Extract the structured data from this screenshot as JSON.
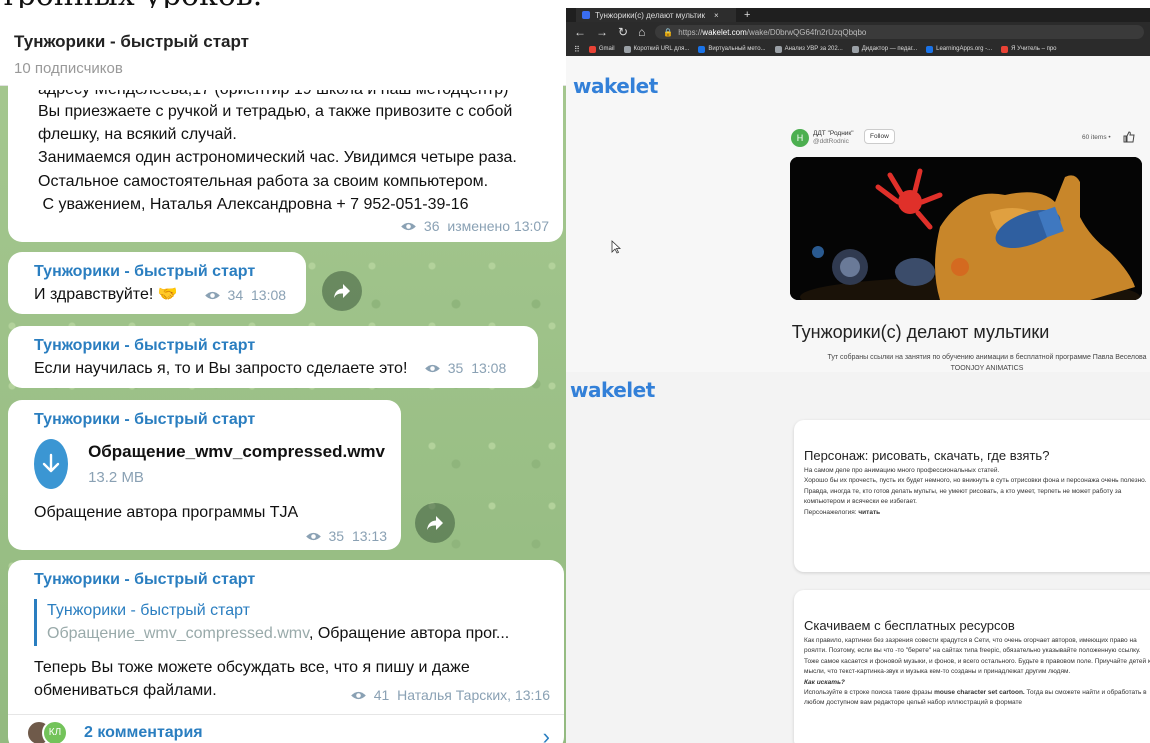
{
  "doc_fragment": "тронных уроков.",
  "telegram": {
    "channel_title": "Тунжорики - быстрый старт",
    "subscribers": "10 подписчиков",
    "messages": [
      {
        "cut_line": "адресу Менделеева,17 (ориентир 19 школа и наш методцентр)",
        "lines": [
          "Вы приезжаете с ручкой и тетрадью, а также привозите с собой",
          "флешку, на всякий случай.",
          "Занимаемся один астрономический час. Увидимся четыре раза.",
          "Остальное самостоятельная работа за своим компьютером.",
          " С уважением, Наталья Александровна + 7 952-051-39-16"
        ],
        "views": "36",
        "time": "изменено 13:07"
      },
      {
        "sender": "Тунжорики - быстрый старт",
        "text": "И здравствуйте! 🤝",
        "views": "34",
        "time": "13:08"
      },
      {
        "sender": "Тунжорики - быстрый старт",
        "text": "Если научилась я, то и Вы запросто сделаете это!",
        "views": "35",
        "time": "13:08"
      },
      {
        "sender": "Тунжорики - быстрый старт",
        "file_name": "Обращение_wmv_compressed.wmv",
        "file_size": "13.2 MB",
        "caption": "Обращение автора программы TJA",
        "views": "35",
        "time": "13:13"
      },
      {
        "sender": "Тунжорики - быстрый старт",
        "reply_sender": "Тунжорики - быстрый старт",
        "reply_file": "Обращение_wmv_compressed.wmv",
        "reply_text": ", Обращение автора прог...",
        "lines": [
          "Теперь Вы тоже можете обсуждать все, что я пишу и даже",
          "обмениваться файлами."
        ],
        "views": "41",
        "time": "Наталья Тарских, 13:16",
        "avatar2": "КЛ",
        "comments": "2 комментария"
      }
    ]
  },
  "browser": {
    "tab_title": "Тунжорики(с) делают мультики",
    "url_prefix": "https://",
    "url_host": "wakelet.com",
    "url_path": "/wake/D0brwQG64fn2rUzqQbqbo",
    "bookmarks": [
      "Gmail",
      "Короткий URL для...",
      "Виртуальный мето...",
      "Анализ УВР за 202...",
      "Дидактор — педаг...",
      "LearningApps.org -...",
      "Я Учитель – про"
    ],
    "bookmark_colors": [
      "#e94235",
      "#9aa0a6",
      "#1a73e8",
      "#9aa0a6",
      "#9aa0a6",
      "#1a73e8",
      "#e94235"
    ],
    "logo": "wakelet",
    "author_initial": "Н",
    "author_name": "ДДТ \"Родник\"",
    "author_handle": "@ddtRodnic",
    "follow": "Follow",
    "items_count": "60 items  •",
    "collection_title": "Тунжорики(с) делают мультики",
    "collection_desc": "Тут собраны ссылки на занятия по обучению анимации в бесплатной программе Павла Веселова TOONJOY ANIMATICS"
  },
  "wakelet_cards": [
    {
      "title": "Персонаж: рисовать, скачать, где взять?",
      "paras": [
        "На самом деле про анимацию много профессиональных статей.",
        "Хорошо бы их прочесть, пусть их будет немного, но вникнуть в суть отрисовки фона и персонажа очень полезно.",
        "Правда, иногда те, кто готов делать мульты, не умеют рисовать, а кто умеет, терпеть не может работу за компьютером и всячески ее избегает."
      ],
      "last_prefix": "Персонажелогия: ",
      "last_bold": "читать"
    },
    {
      "title": "Скачиваем с бесплатных ресурсов",
      "paras": [
        "Как правило, картинки без зазрения совести крадутся в Сети, что очень огорчает авторов, имеющих право на роялти. Поэтому, если вы что -то \"берете\" на сайтах типа freepic, обязательно указывайте положенную ссылку.",
        "Тоже самое касается и фоновой музыки, и фонов, и всего остального. Будьте в правовом поле. Приучайте детей к мысли, что текст-картинка-звук и музыка кем-то созданы и принадлежат другим людям."
      ],
      "question": "Как искать?",
      "last_prefix": "Используйте в строке поиска такие фразы ",
      "last_bold": "mouse character set cartoon.",
      "last_suffix": " Тогда вы сможете найти и обработать в любом доступном вам редакторе целый набор иллюстраций в формате"
    }
  ]
}
